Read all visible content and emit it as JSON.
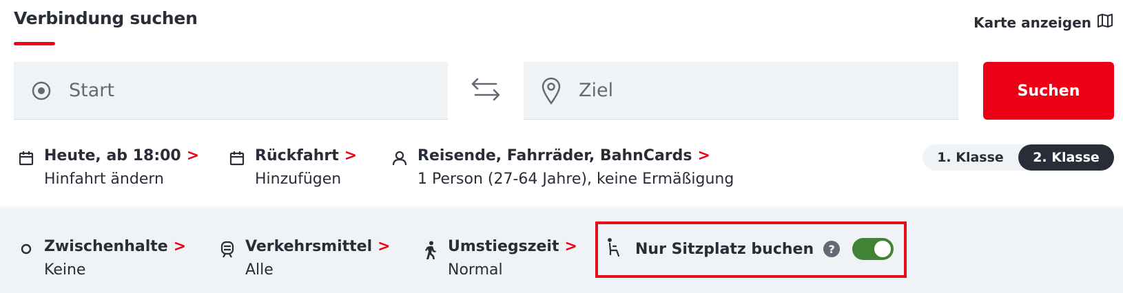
{
  "header": {
    "title": "Verbindung suchen",
    "map_link": "Karte anzeigen",
    "map_icon": "map-icon"
  },
  "search": {
    "start_placeholder": "Start",
    "ziel_placeholder": "Ziel",
    "submit_label": "Suchen"
  },
  "options": {
    "hinfahrt": {
      "label": "Heute, ab 18:00",
      "sub": "Hinfahrt ändern",
      "icon": "calendar-icon"
    },
    "rueckfahrt": {
      "label": "Rückfahrt",
      "sub": "Hinzufügen",
      "icon": "calendar-icon"
    },
    "reisende": {
      "label": "Reisende, Fahrräder, BahnCards",
      "sub": "1 Person (27-64 Jahre), keine Ermäßigung",
      "icon": "person-icon"
    }
  },
  "klasse": {
    "first": "1. Klasse",
    "second": "2. Klasse",
    "selected": "2. Klasse"
  },
  "filters": {
    "zwischenhalte": {
      "label": "Zwischenhalte",
      "sub": "Keine"
    },
    "verkehrsmittel": {
      "label": "Verkehrsmittel",
      "sub": "Alle"
    },
    "umstiegszeit": {
      "label": "Umstiegszeit",
      "sub": "Normal"
    },
    "sitzplatz": {
      "label": "Nur Sitzplatz buchen",
      "help": "?",
      "enabled": true
    }
  },
  "colors": {
    "brand_red": "#ec0016",
    "toggle_green": "#408335",
    "text_dark": "#282d37",
    "field_bg": "#f0f3f5"
  }
}
